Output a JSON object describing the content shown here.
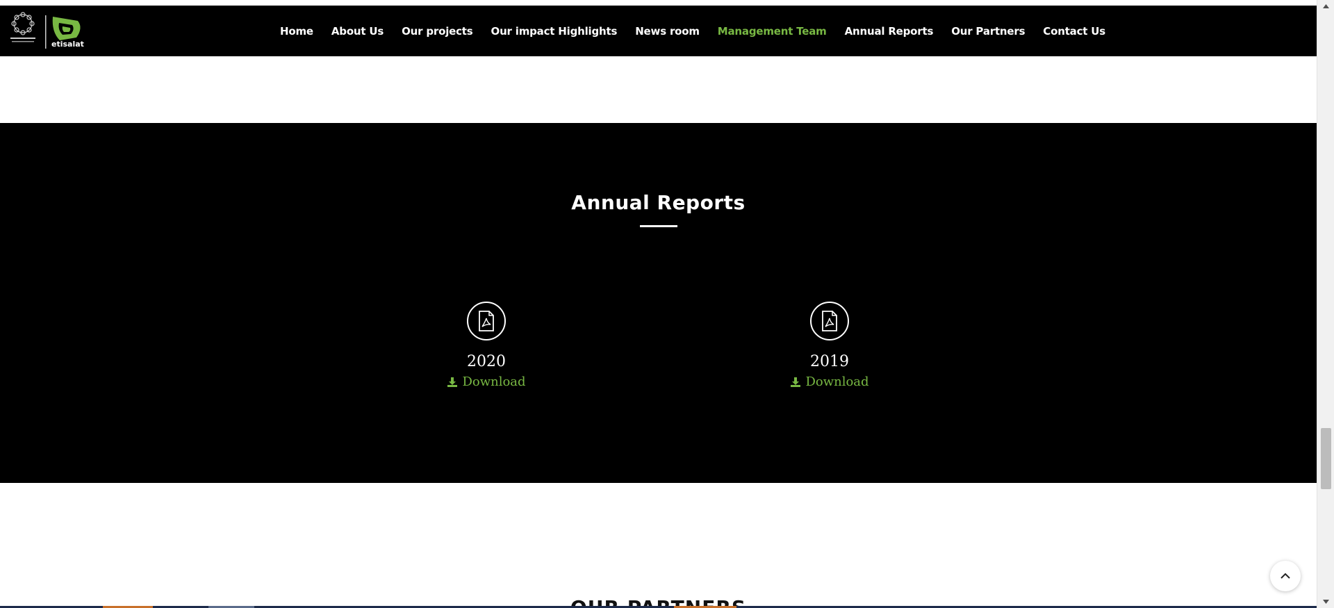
{
  "brand": {
    "logo_text": "etisalat",
    "accent_color": "#78b843"
  },
  "nav": {
    "items": [
      {
        "label": "Home",
        "active": false
      },
      {
        "label": "About Us",
        "active": false
      },
      {
        "label": "Our projects",
        "active": false
      },
      {
        "label": "Our impact Highlights",
        "active": false
      },
      {
        "label": "News room",
        "active": false
      },
      {
        "label": "Management Team",
        "active": true
      },
      {
        "label": "Annual Reports",
        "active": false
      },
      {
        "label": "Our Partners",
        "active": false
      },
      {
        "label": "Contact Us",
        "active": false
      }
    ]
  },
  "annual_reports": {
    "title": "Annual Reports",
    "reports": [
      {
        "year": "2020",
        "download_label": "Download",
        "icon": "pdf-icon"
      },
      {
        "year": "2019",
        "download_label": "Download",
        "icon": "pdf-icon"
      }
    ]
  },
  "partners": {
    "title": "OUR PARTNERS"
  },
  "controls": {
    "scroll_top_icon": "chevron-up-icon"
  }
}
